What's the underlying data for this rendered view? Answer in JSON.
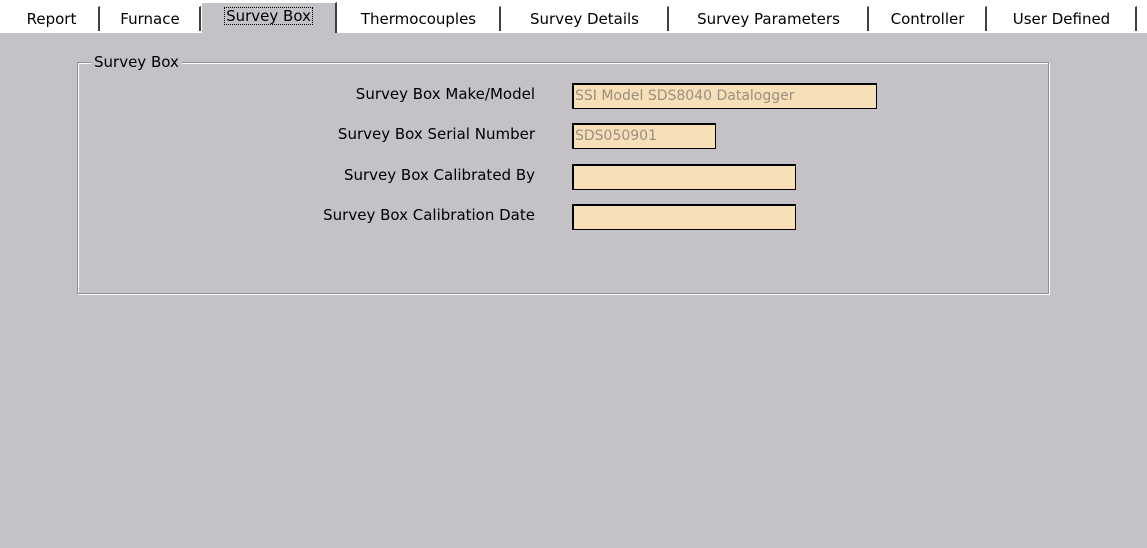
{
  "tabs": [
    {
      "label": "Report"
    },
    {
      "label": "Furnace"
    },
    {
      "label": "Survey Box"
    },
    {
      "label": "Thermocouples"
    },
    {
      "label": "Survey Details"
    },
    {
      "label": "Survey Parameters"
    },
    {
      "label": "Controller"
    },
    {
      "label": "User Defined"
    }
  ],
  "active_tab": "Survey Box",
  "group": {
    "title": "Survey Box",
    "fields": [
      {
        "label": "Survey Box Make/Model",
        "value": "SSI Model SDS8040 Datalogger"
      },
      {
        "label": "Survey Box Serial Number",
        "value": "SDS050901"
      },
      {
        "label": "Survey Box Calibrated By",
        "value": ""
      },
      {
        "label": "Survey Box Calibration Date",
        "value": ""
      }
    ]
  },
  "colors": {
    "panel_background": "#c4c1c7",
    "input_background": "#f7dfb8",
    "input_text": "#9a8f80"
  }
}
